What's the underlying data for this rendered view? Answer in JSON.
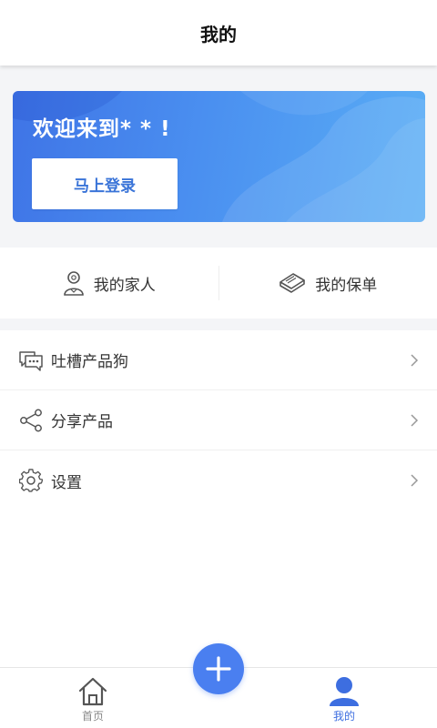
{
  "header": {
    "title": "我的"
  },
  "banner": {
    "welcome": "欢迎来到* * !",
    "login_label": "马上登录"
  },
  "quick": [
    {
      "label": "我的家人",
      "icon": "family-person-icon"
    },
    {
      "label": "我的保单",
      "icon": "policy-book-icon"
    }
  ],
  "menu": [
    {
      "label": "吐槽产品狗",
      "icon": "feedback-chat-icon"
    },
    {
      "label": "分享产品",
      "icon": "share-icon"
    },
    {
      "label": "设置",
      "icon": "gear-icon"
    }
  ],
  "tabbar": {
    "home": {
      "label": "首页",
      "icon": "home-icon"
    },
    "add": {
      "icon": "plus-icon"
    },
    "mine": {
      "label": "我的",
      "icon": "user-icon"
    }
  },
  "colors": {
    "accent": "#4a7ff0",
    "banner_start": "#3f74e6",
    "banner_end": "#5aaef5",
    "active_tab": "#3d6ee0"
  }
}
